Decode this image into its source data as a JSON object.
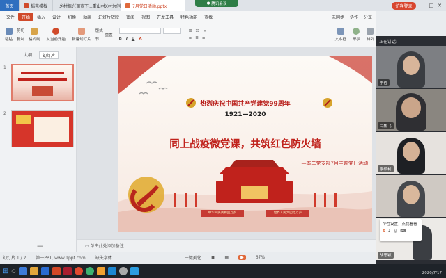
{
  "titlebar": {
    "home": "首页",
    "tab1": "稻壳模板",
    "tab2": "乡村振兴调查下...重山村X村为例",
    "tab3": "7月党日活动.pptx",
    "login": "访客登录",
    "meeting": "腾讯会议"
  },
  "menu": {
    "items": [
      "文件",
      "开始",
      "插入",
      "设计",
      "切换",
      "动画",
      "幻灯片放映",
      "审阅",
      "视图",
      "开发工具",
      "特色功能",
      "查找"
    ],
    "active_index": 1,
    "right": [
      "未同步",
      "协作",
      "分享"
    ]
  },
  "ribbon": {
    "paste": "粘贴",
    "cut": "剪切",
    "copy": "复制",
    "format_painter": "格式刷",
    "from_current": "从当前开始",
    "new_slide": "新建幻灯片",
    "layout": "版式",
    "section": "节",
    "reset": "重置",
    "font_name": "",
    "font_size": "",
    "textbox": "文本框",
    "shape": "形状",
    "arrange": "排列"
  },
  "leftpanel": {
    "tabs": [
      "大纲",
      "幻灯片"
    ],
    "slide_nums": [
      "1",
      "2"
    ]
  },
  "slide": {
    "heading": "热烈庆祝中国共产党建党99周年",
    "years": "1921—2020",
    "main_title": "同上战疫微党课，共筑红色防火墙",
    "subtitle": "—本二党支部7月主题党日活动",
    "banner_left": "中华人民共和国万岁",
    "banner_right": "世界人民大团结万岁"
  },
  "notes": {
    "placeholder": "单击此处添加备注"
  },
  "status": {
    "slide_info": "幻灯片 1 / 2",
    "theme": "第一PPT, www.1ppt.com",
    "font_missing": "缺失字体",
    "beautify": "一键美化",
    "zoom": "67%"
  },
  "meeting": {
    "speaking_label": "正在讲话:",
    "participants": [
      "李哲",
      "闫鹏飞",
      "李硕利",
      "",
      "胡思颖"
    ],
    "tip_items": [
      "个性设置，点我看看"
    ]
  },
  "taskbar": {
    "time": "",
    "date": "2020/7/17"
  },
  "colors": {
    "accent": "#d04a2a",
    "slide_red": "#c0221c",
    "taskbar": "#1e2329"
  }
}
